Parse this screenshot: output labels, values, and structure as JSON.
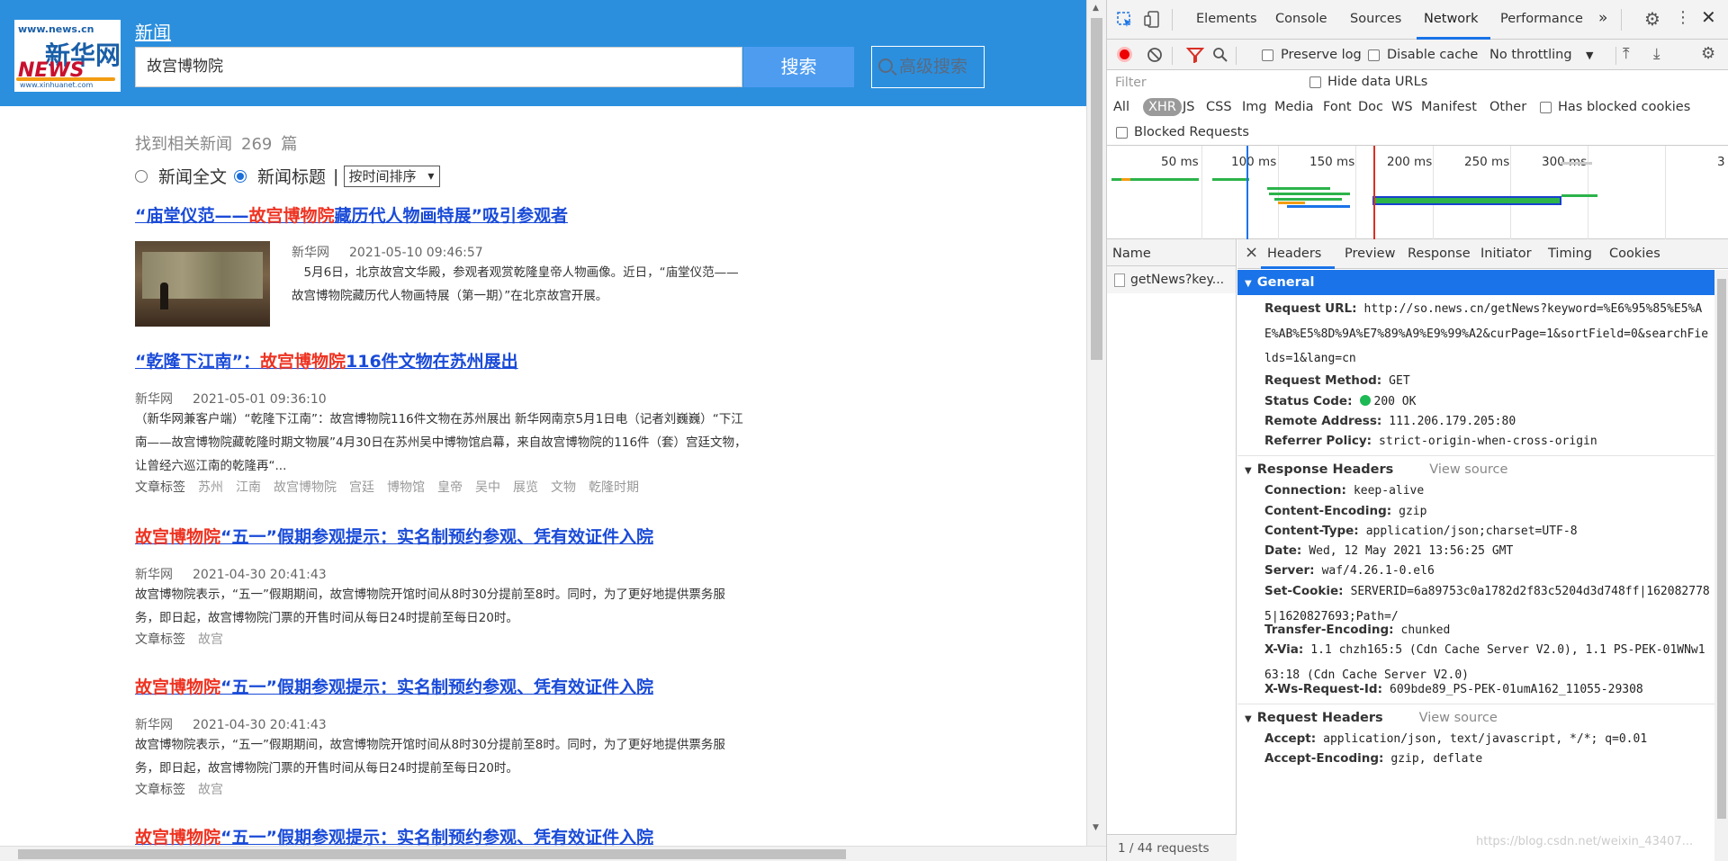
{
  "header": {
    "logo": {
      "domain": "www.news.cn",
      "brand_cn": "新华网",
      "brand_en": "NEWS",
      "domain2": "www.xinhuanet.com"
    },
    "site_link": "新闻",
    "search_value": "故宫博物院",
    "search_button": "搜索",
    "advanced_button": "高级搜索"
  },
  "results": {
    "count_prefix": "找到相关新闻",
    "count": "269",
    "count_suffix": "篇",
    "opt_fulltext": "新闻全文",
    "opt_title": "新闻标题",
    "separator": "|",
    "sort": "按时间排序",
    "tags_label": "文章标签",
    "items": [
      {
        "title_a": "“庙堂仪范——",
        "title_hl": "故宫博物院",
        "title_b": "藏历代人物画特展”吸引参观者",
        "source": "新华网",
        "date": "2021-05-10 09:46:57",
        "summary": "　5月6日，北京故宫文华殿，参观者观赏乾隆皇帝人物画像。近日，“庙堂仪范——故宫博物院藏历代人物画特展（第一期）”在北京故宫开展。"
      },
      {
        "title_a": "“乾隆下江南”：",
        "title_hl": "故宫博物院",
        "title_b": "116件文物在苏州展出",
        "source": "新华网",
        "date": "2021-05-01 09:36:10",
        "summary": "（新华网兼客户端）“乾隆下江南”：故宫博物院116件文物在苏州展出 新华网南京5月1日电（记者刘巍巍）“下江南——故宫博物院藏乾隆时期文物展”4月30日在苏州吴中博物馆启幕，来自故宫博物院的116件（套）宫廷文物，让曾经六巡江南的乾隆再“...",
        "tags": [
          "苏州",
          "江南",
          "故宫博物院",
          "宫廷",
          "博物馆",
          "皇帝",
          "吴中",
          "展览",
          "文物",
          "乾隆时期"
        ]
      },
      {
        "title_a": "",
        "title_hl": "故宫博物院",
        "title_b": "“五一”假期参观提示：实名制预约参观、凭有效证件入院",
        "source": "新华网",
        "date": "2021-04-30 20:41:43",
        "summary": "故宫博物院表示，“五一”假期期间，故宫博物院开馆时间从8时30分提前至8时。同时，为了更好地提供票务服务，即日起，故宫博物院门票的开售时间从每日24时提前至每日20时。",
        "tags": [
          "故宫"
        ]
      },
      {
        "title_a": "",
        "title_hl": "故宫博物院",
        "title_b": "“五一”假期参观提示：实名制预约参观、凭有效证件入院",
        "source": "新华网",
        "date": "2021-04-30 20:41:43",
        "summary": "故宫博物院表示，“五一”假期期间，故宫博物院开馆时间从8时30分提前至8时。同时，为了更好地提供票务服务，即日起，故宫博物院门票的开售时间从每日24时提前至每日20时。",
        "tags": [
          "故宫"
        ]
      },
      {
        "title_a": "",
        "title_hl": "故宫博物院",
        "title_b": "“五一”假期参观提示：实名制预约参观、凭有效证件入院"
      }
    ]
  },
  "devtools": {
    "tabs": [
      "Elements",
      "Console",
      "Sources",
      "Network",
      "Performance"
    ],
    "active_tab": "Network",
    "more": "»",
    "toolbar": {
      "preserve_log": "Preserve log",
      "disable_cache": "Disable cache",
      "throttling": "No throttling"
    },
    "filter_placeholder": "Filter",
    "hide_data_urls": "Hide data URLs",
    "types": [
      "All",
      "XHR",
      "JS",
      "CSS",
      "Img",
      "Media",
      "Font",
      "Doc",
      "WS",
      "Manifest",
      "Other"
    ],
    "selected_type": "XHR",
    "has_blocked_cookies": "Has blocked cookies",
    "blocked_requests": "Blocked Requests",
    "timeline_ticks": [
      "50 ms",
      "100 ms",
      "150 ms",
      "200 ms",
      "250 ms",
      "300 ms",
      "3"
    ],
    "name_header": "Name",
    "request_name": "getNews?key...",
    "footer": "1 / 44 requests",
    "detail_tabs": [
      "Headers",
      "Preview",
      "Response",
      "Initiator",
      "Timing",
      "Cookies"
    ],
    "active_detail_tab": "Headers",
    "general": {
      "title": "General",
      "request_url_k": "Request URL:",
      "request_url_v": "http://so.news.cn/getNews?keyword=%E6%95%85%E5%AE%AB%E5%8D%9A%E7%89%A9%E9%99%A2&curPage=1&sortField=0&searchFields=1&lang=cn",
      "method_k": "Request Method:",
      "method_v": "GET",
      "status_k": "Status Code:",
      "status_v": "200 OK",
      "remote_k": "Remote Address:",
      "remote_v": "111.206.179.205:80",
      "referrer_k": "Referrer Policy:",
      "referrer_v": "strict-origin-when-cross-origin"
    },
    "response_headers": {
      "title": "Response Headers",
      "view_source": "View source",
      "rows": [
        {
          "k": "Connection:",
          "v": "keep-alive"
        },
        {
          "k": "Content-Encoding:",
          "v": "gzip"
        },
        {
          "k": "Content-Type:",
          "v": "application/json;charset=UTF-8"
        },
        {
          "k": "Date:",
          "v": "Wed, 12 May 2021 13:56:25 GMT"
        },
        {
          "k": "Server:",
          "v": "waf/4.26.1-0.el6"
        },
        {
          "k": "Set-Cookie:",
          "v": "SERVERID=6a89753c0a1782d2f83c5204d3d748ff|1620827785|1620827693;Path=/"
        },
        {
          "k": "Transfer-Encoding:",
          "v": "chunked"
        },
        {
          "k": "X-Via:",
          "v": "1.1 chzh165:5 (Cdn Cache Server V2.0), 1.1 PS-PEK-01WNw163:18 (Cdn Cache Server V2.0)"
        },
        {
          "k": "X-Ws-Request-Id:",
          "v": "609bde89_PS-PEK-01umA162_11055-29308"
        }
      ]
    },
    "request_headers": {
      "title": "Request Headers",
      "view_source": "View source",
      "rows": [
        {
          "k": "Accept:",
          "v": "application/json, text/javascript, */*; q=0.01"
        },
        {
          "k": "Accept-Encoding:",
          "v": "gzip, deflate"
        }
      ]
    }
  },
  "watermark": "https://blog.csdn.net/weixin_43407..."
}
